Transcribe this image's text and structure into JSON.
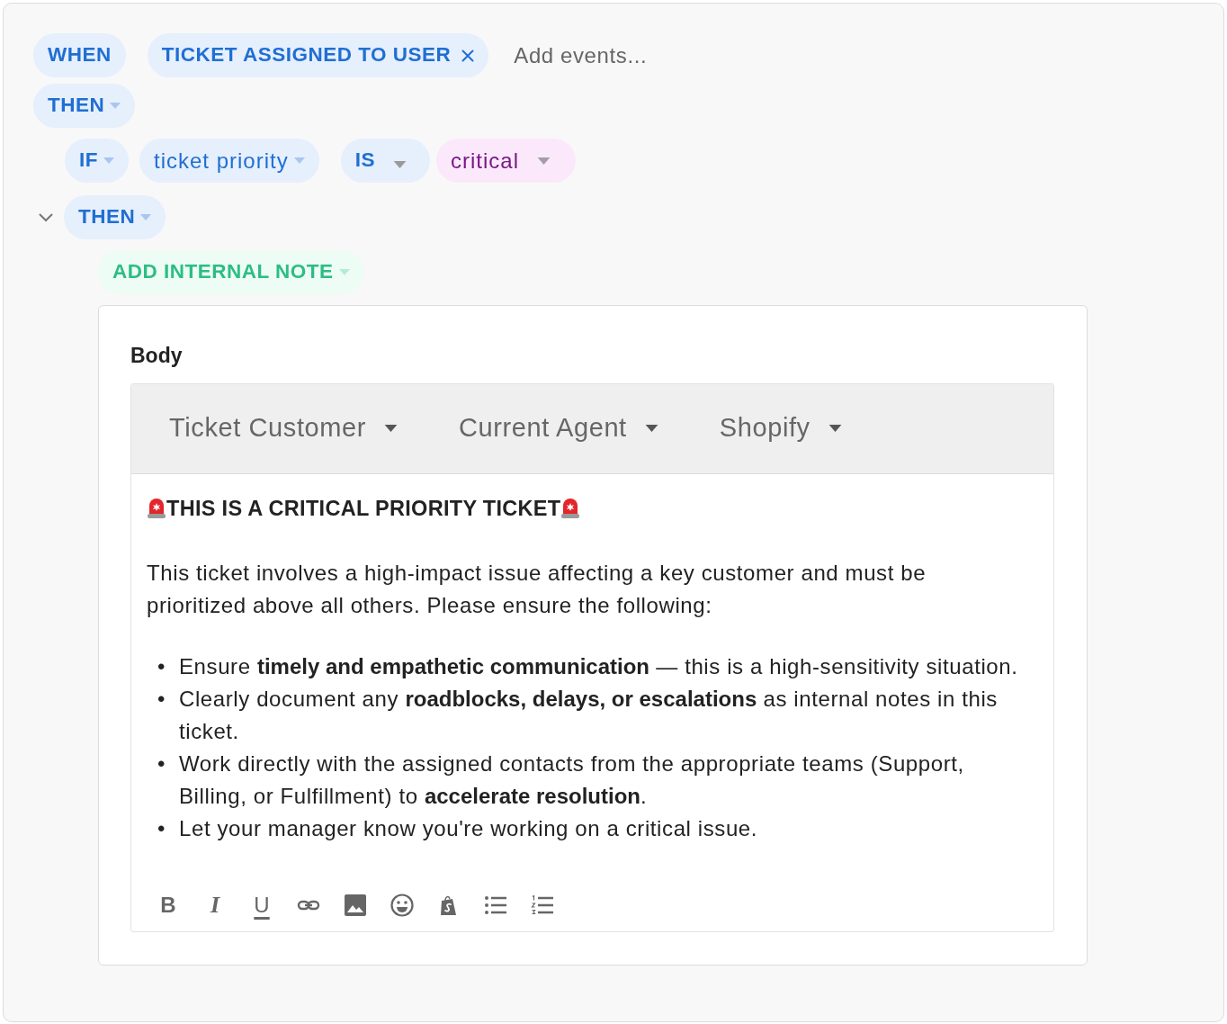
{
  "trigger": {
    "label": "WHEN",
    "events": [
      {
        "label": "TICKET ASSIGNED TO USER",
        "removable": true
      }
    ],
    "placeholder": "Add events..."
  },
  "then": {
    "label": "THEN"
  },
  "condition": {
    "keyword": "IF",
    "field": "ticket priority",
    "operator": "IS",
    "value": "critical"
  },
  "branch": {
    "label": "THEN",
    "expanded": true,
    "action": {
      "label": "ADD INTERNAL NOTE",
      "field_label": "Body",
      "variable_menus": [
        "Ticket Customer",
        "Current Agent",
        "Shopify"
      ],
      "heading": "THIS IS A CRITICAL PRIORITY TICKET",
      "paragraph": "This ticket involves a high-impact issue affecting a key customer and must be prioritized above all others. Please ensure the following:",
      "bullets": [
        {
          "marker": "•",
          "text": "Ensure **timely and empathetic communication** — this is a high-sensitivity situation."
        },
        {
          "marker": "•",
          "text": "Clearly document any **roadblocks, delays, or escalations** as internal notes in this ticket."
        },
        {
          "marker": "•",
          "text": "Work directly with the assigned contacts from the appropriate teams (Support, Billing, or Fulfillment) to **accelerate resolution**."
        },
        {
          "marker": "•",
          "text": "Let your manager know you're working on a critical issue."
        }
      ],
      "format_tools": [
        {
          "kind": "bold",
          "glyph": "B"
        },
        {
          "kind": "italic",
          "glyph": "I"
        },
        {
          "kind": "underline",
          "glyph": "U"
        },
        {
          "kind": "link"
        },
        {
          "kind": "image"
        },
        {
          "kind": "emoji"
        },
        {
          "kind": "shopify"
        },
        {
          "kind": "bulleted-list"
        },
        {
          "kind": "numbered-list"
        }
      ]
    }
  }
}
